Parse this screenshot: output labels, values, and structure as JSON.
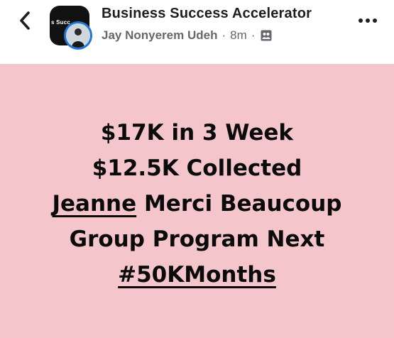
{
  "header": {
    "back_icon": "chevron-left-icon",
    "group_name": "Business Success Accelerator",
    "group_logo_text": "s Succ",
    "author": "Jay Nonyerem Udeh",
    "separator": "·",
    "time": "8m",
    "privacy_icon": "group-members-icon",
    "more_icon": "more-horizontal-icon"
  },
  "post": {
    "background": "#f4c6cb",
    "line1": "$17K in 3 Week",
    "line2": "$12.5K Collected",
    "line3_mention": "Jeanne",
    "line3_rest": " Merci Beaucoup",
    "line4": "Group Program Next",
    "line5_hashtag": "#50KMonths"
  }
}
